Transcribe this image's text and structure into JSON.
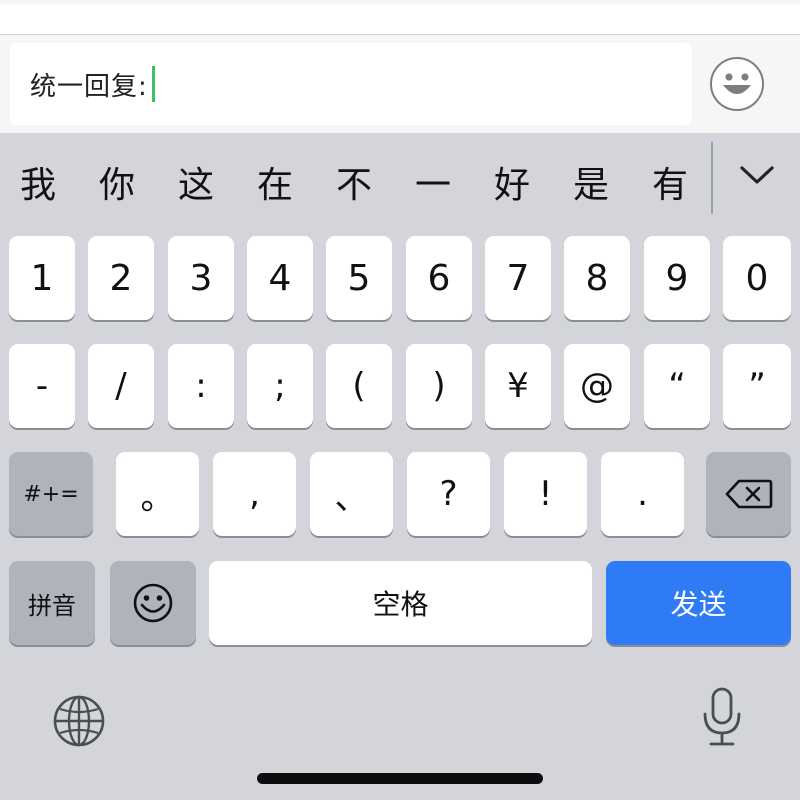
{
  "compose": {
    "reply_prefix": "统一回复:",
    "emoji_toggle_icon": "emoji-face-icon",
    "cursor_color": "#3cc06a"
  },
  "candidates": {
    "items": [
      "我",
      "你",
      "这",
      "在",
      "不",
      "一",
      "好",
      "是",
      "有"
    ],
    "expand_icon": "chevron-down-icon"
  },
  "keyboard": {
    "row1": [
      "1",
      "2",
      "3",
      "4",
      "5",
      "6",
      "7",
      "8",
      "9",
      "0"
    ],
    "row2": [
      "-",
      "/",
      ":",
      ";",
      "(",
      ")",
      "¥",
      "@",
      "“",
      "”"
    ],
    "row3": {
      "mode_toggle": "#+=",
      "keys": [
        "。",
        ",",
        "、",
        "?",
        "!",
        "."
      ],
      "delete_icon": "backspace-icon"
    },
    "row4": {
      "pinyin": "拼音",
      "emoji_icon": "emoji-face-icon",
      "space": "空格",
      "send": "发送"
    },
    "bottom": {
      "globe_icon": "globe-icon",
      "mic_icon": "microphone-icon"
    }
  },
  "colors": {
    "keyboard_bg": "#d3d5db",
    "send_key": "#2f7bf6",
    "function_key": "#aeb3bc"
  }
}
